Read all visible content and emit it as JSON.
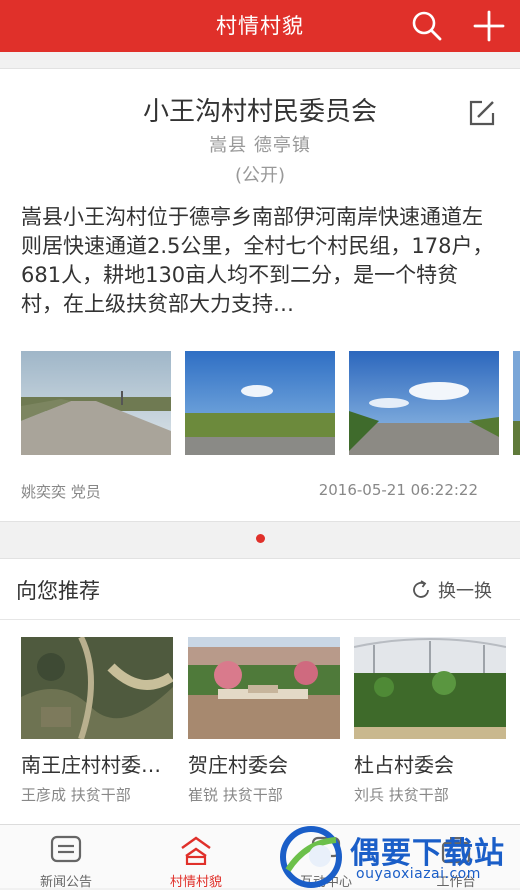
{
  "header": {
    "title": "村情村貌",
    "search_icon": "search-icon",
    "add_icon": "plus-icon",
    "color": "#e0302a"
  },
  "village": {
    "name": "小王沟村村民委员会",
    "location": "嵩县 德亭镇",
    "visibility": "(公开)",
    "description": "嵩县小王沟村位于德亭乡南部伊河南岸快速通道左则居快速通道2.5公里，全村七个村民组，178户，681人，耕地130亩人均不到二分，是一个特贫村，在上级扶贫部大力支持…",
    "author": "姚奕奕 党员",
    "timestamp": "2016-05-21 06:22:22",
    "edit_icon": "edit-icon"
  },
  "recommend": {
    "title": "向您推荐",
    "refresh_label": "换一换",
    "items": [
      {
        "name": "南王庄村村委…",
        "meta": "王彦成 扶贫干部"
      },
      {
        "name": "贺庄村委会",
        "meta": "崔锐 扶贫干部"
      },
      {
        "name": "杜占村委会",
        "meta": "刘兵 扶贫干部"
      }
    ]
  },
  "tabs": [
    {
      "label": "新闻公告",
      "icon": "news-icon",
      "active": false
    },
    {
      "label": "村情村貌",
      "icon": "village-icon",
      "active": true
    },
    {
      "label": "互动中心",
      "icon": "chat-icon",
      "active": false
    },
    {
      "label": "工作台",
      "icon": "workbench-icon",
      "active": false
    }
  ],
  "watermark": {
    "title": "偶要下载站",
    "url": "ouyaoxiazai.com"
  }
}
